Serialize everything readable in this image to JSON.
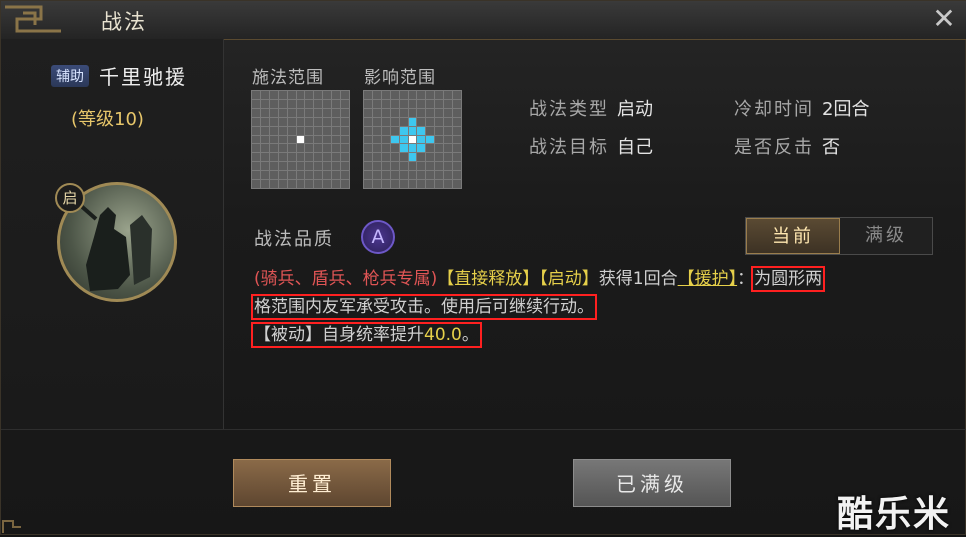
{
  "window": {
    "title": "战法",
    "close_label": "✕"
  },
  "skill": {
    "tag": "辅助",
    "name": "千里驰援",
    "level": "(等级10)",
    "portrait_badge": "启"
  },
  "grids": {
    "cast_label": "施法范围",
    "effect_label": "影响范围"
  },
  "info": {
    "type_key": "战法类型",
    "type_val": "启动",
    "cooldown_key": "冷却时间",
    "cooldown_val": "2回合",
    "target_key": "战法目标",
    "target_val": "自己",
    "counter_key": "是否反击",
    "counter_val": "否"
  },
  "quality": {
    "label": "战法品质",
    "grade": "A"
  },
  "toggle": {
    "current": "当前",
    "max": "满级"
  },
  "description": {
    "troop_limit": "(骑兵、盾兵、枪兵专属)",
    "tag_direct": "【直接释放】",
    "tag_active": "【启动】",
    "gain_text": "获得1回合",
    "tag_assist": "【援护】",
    "colon": "：",
    "highlight1": "为圆形两",
    "line2": "格范围内友军承受攻击。使用后可继续行动。",
    "passive_tag": "【被动】",
    "passive_text": "自身统率提升",
    "passive_value": "40.0",
    "passive_end": "。"
  },
  "buttons": {
    "reset": "重置",
    "maxed": "已满级"
  },
  "watermark": "酷乐米",
  "colors": {
    "accent_gold": "#e7c66a",
    "troop_red": "#e05555",
    "highlight_yellow": "#e6d04a",
    "grid_blue": "#3ec7ef"
  }
}
